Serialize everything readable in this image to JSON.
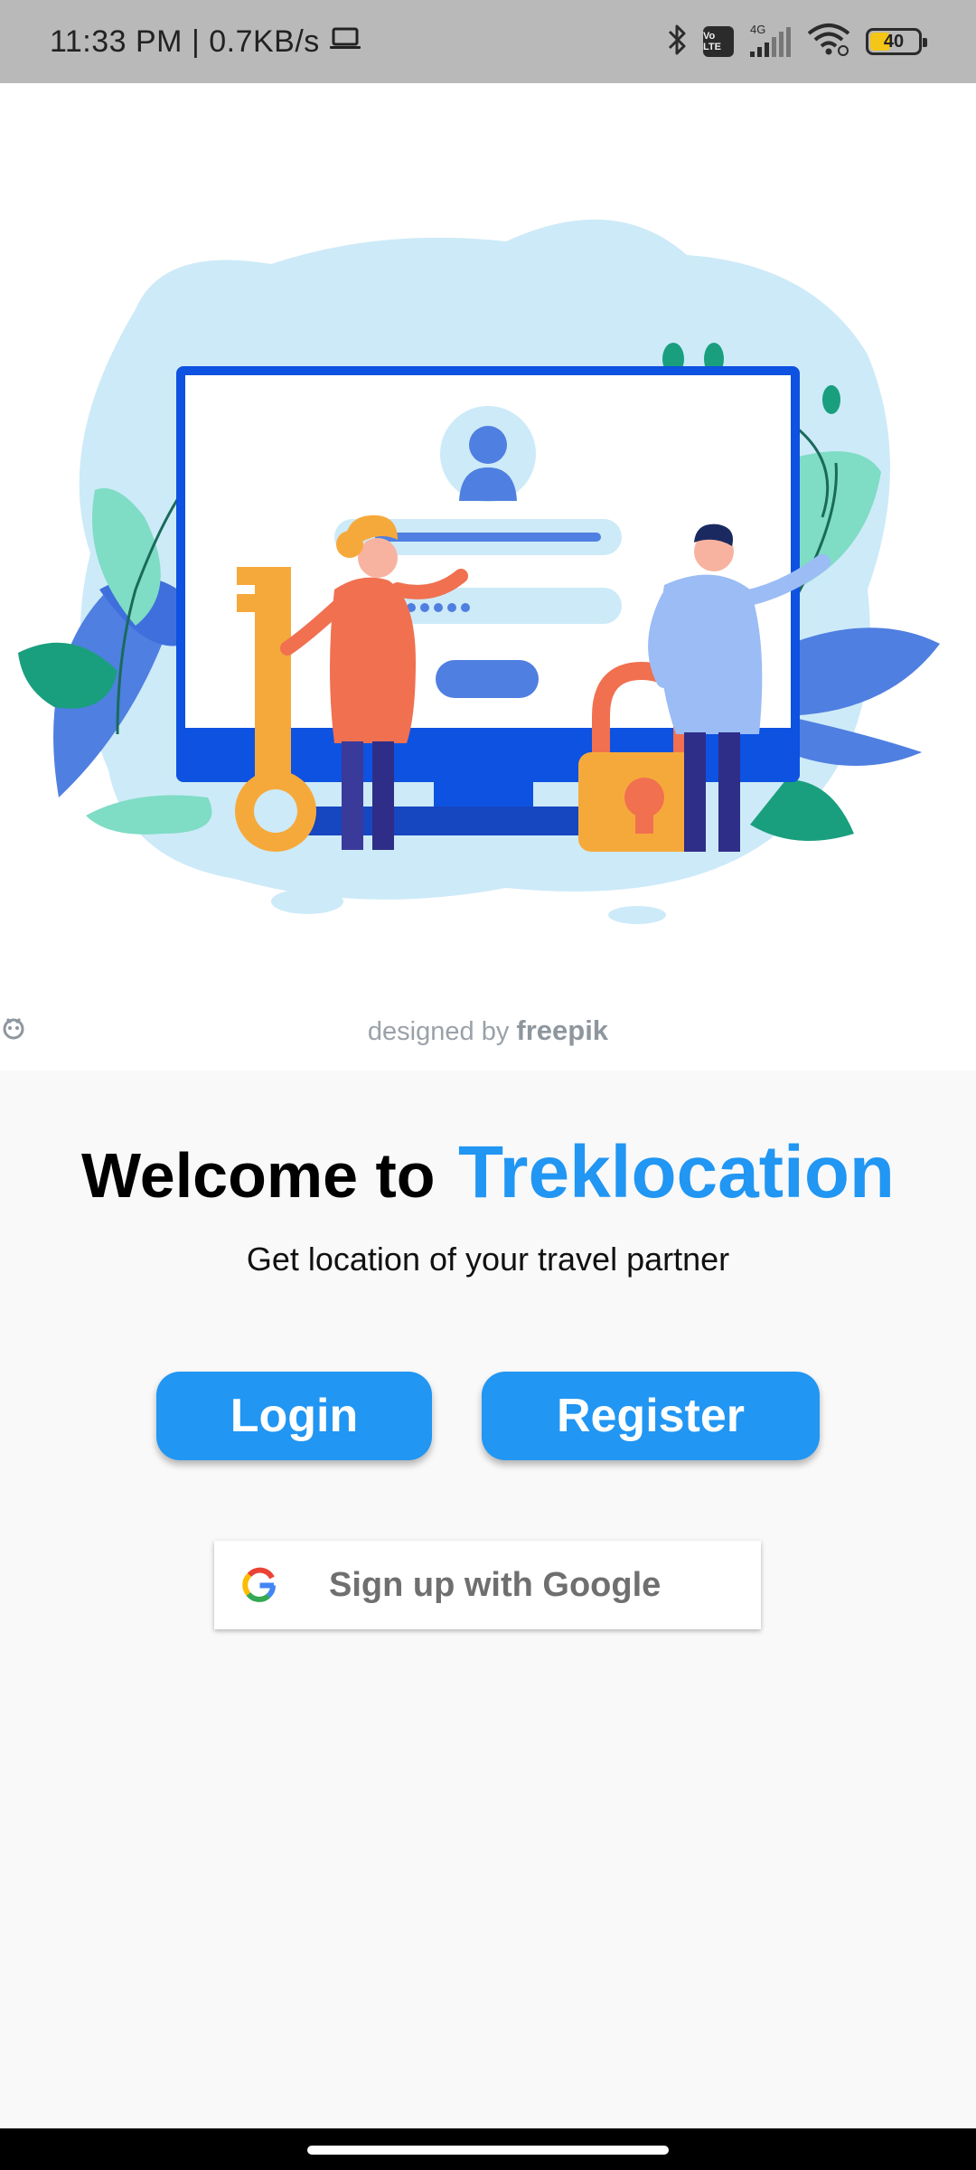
{
  "status_bar": {
    "time_speed": "11:33 PM | 0.7KB/s",
    "volte": "Vo LTE",
    "network": "4G",
    "battery": "40"
  },
  "hero": {
    "credit_prefix": "designed by",
    "credit_brand": "freepik"
  },
  "welcome": {
    "prefix": "Welcome to",
    "app_name": "Treklocation",
    "tagline": "Get location of your travel partner"
  },
  "buttons": {
    "login": "Login",
    "register": "Register",
    "google": "Sign up with Google"
  },
  "colors": {
    "accent": "#2196f3",
    "status_bar": "#b9b9b9",
    "background": "#f9f9f9"
  },
  "icons": [
    "laptop-icon",
    "bluetooth-icon",
    "signal-icon",
    "wifi-icon",
    "battery-icon",
    "google-icon",
    "freepik-logo"
  ]
}
